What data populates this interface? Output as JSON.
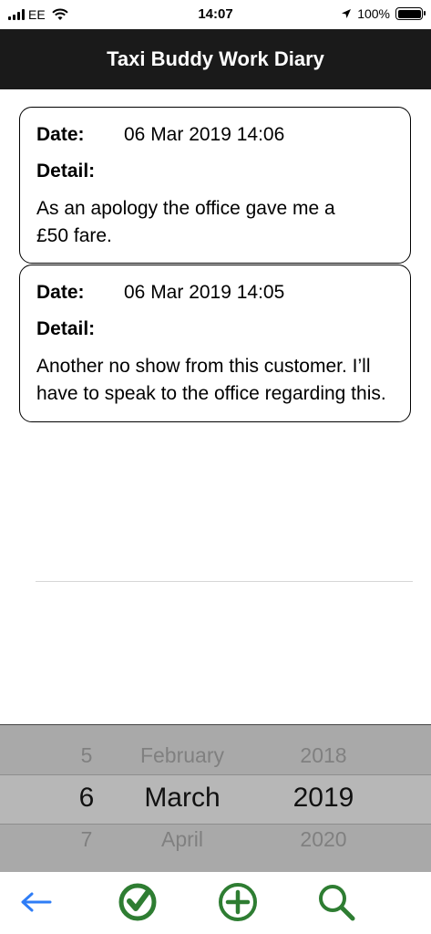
{
  "status_bar": {
    "carrier": "EE",
    "time": "14:07",
    "battery": "100%"
  },
  "header": {
    "title": "Taxi Buddy Work Diary"
  },
  "entries": [
    {
      "date_label": "Date:",
      "date_value": "06 Mar 2019 14:06",
      "detail_label": "Detail:",
      "detail_line1": "As an apology the office gave me a",
      "detail_line2": "£50 fare."
    },
    {
      "date_label": "Date:",
      "date_value": "06 Mar 2019 14:05",
      "detail_label": "Detail:",
      "detail_line1": "Another no show from this customer. I’ll",
      "detail_line2": "have to speak to the office regarding this."
    }
  ],
  "picker": {
    "day": {
      "prev": "5",
      "selected": "6",
      "next": "7"
    },
    "month": {
      "prev": "February",
      "selected": "March",
      "next": "April"
    },
    "year": {
      "prev": "2018",
      "selected": "2019",
      "next": "2020"
    }
  },
  "toolbar": {
    "icons": [
      "back-arrow-icon",
      "check-circle-icon",
      "plus-circle-icon",
      "search-icon"
    ],
    "colors": {
      "back": "#2f7df6",
      "actions": "#2e7d32"
    }
  }
}
